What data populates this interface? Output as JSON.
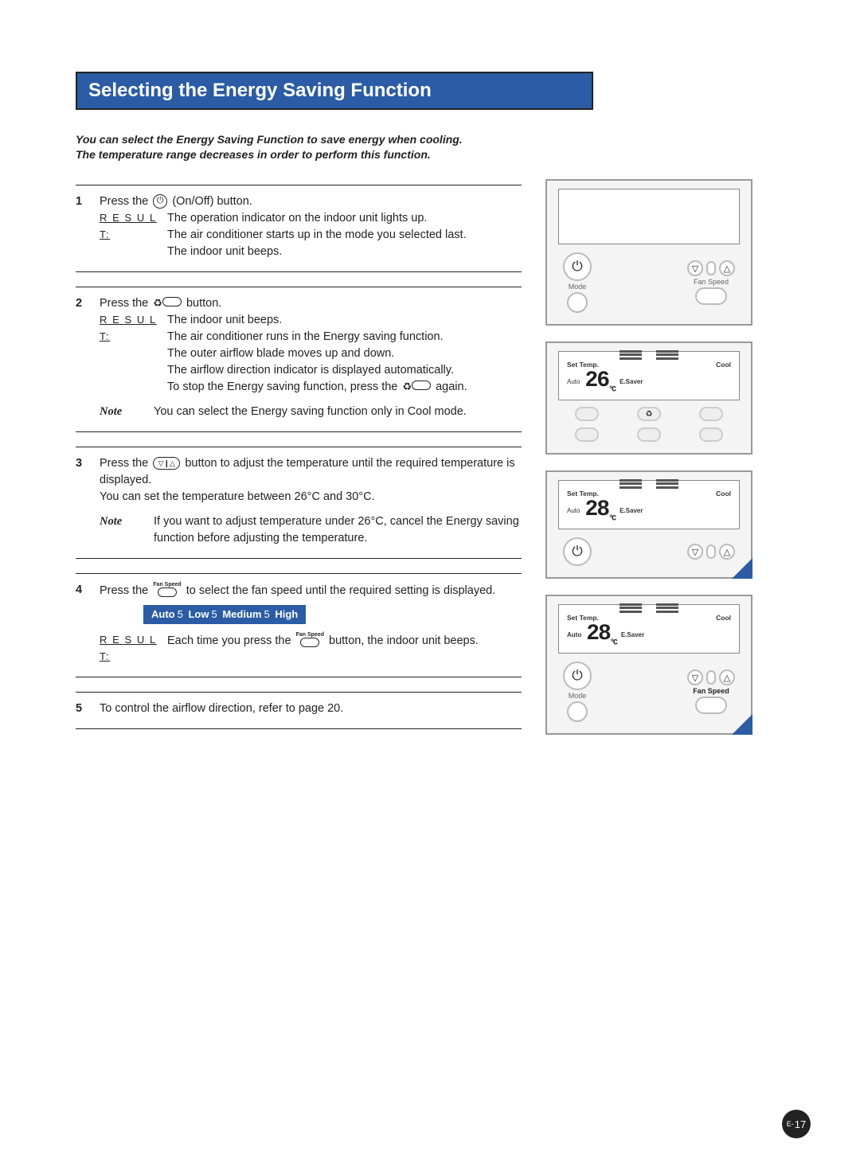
{
  "title": "Selecting the Energy Saving Function",
  "intro_line1": "You can select the Energy Saving Function to save energy when cooling.",
  "intro_line2": "The temperature range decreases in order to perform this function.",
  "steps": {
    "s1": {
      "num": "1",
      "press_a": "Press the ",
      "press_b": " (On/Off) button.",
      "result_label": "R E S U L T:",
      "r1": "The operation indicator on the indoor unit lights up.",
      "r2": "The air conditioner starts up in the mode you selected last.",
      "r3": "The indoor unit beeps."
    },
    "s2": {
      "num": "2",
      "press_a": "Press the ",
      "press_b": " button.",
      "result_label": "R E S U L T:",
      "r1": "The indoor unit beeps.",
      "r2": "The air conditioner runs in the Energy saving function.",
      "r3": "The outer airflow blade moves up and down.",
      "r4": "The airflow direction indicator is displayed automatically.",
      "r5a": "To stop the Energy saving function, press the ",
      "r5b": " again.",
      "note_label": "Note",
      "note": "You can select the Energy saving function only in Cool mode."
    },
    "s3": {
      "num": "3",
      "press_a": "Press the ",
      "press_b": " button to adjust the temperature until the required temperature is displayed.",
      "line2": "You can set the temperature between 26°C and 30°C.",
      "note_label": "Note",
      "note": "If you want to adjust temperature under 26°C, cancel the Energy saving function before adjusting the temperature."
    },
    "s4": {
      "num": "4",
      "press_a": "Press the ",
      "press_b": " to select the fan speed until the required setting is displayed.",
      "cycle": {
        "a": "Auto",
        "b": "Low",
        "c": "Medium",
        "d": "High",
        "sep": "5"
      },
      "result_label": "R E S U L T:",
      "ra": "Each time you press the ",
      "rb": " button, the indoor unit beeps."
    },
    "s5": {
      "num": "5",
      "text": "To control the airflow direction, refer to page 20."
    }
  },
  "panels": {
    "labels": {
      "mode": "Mode",
      "fanspeed": "Fan Speed",
      "fanspeed_bold": "Fan Speed",
      "set_temp": "Set Temp.",
      "cool": "Cool",
      "esaver": "E.Saver",
      "auto": "Auto"
    },
    "temp2": "26",
    "temp3": "28",
    "temp4": "28",
    "unit": "°C"
  },
  "icons": {
    "power": "⏻",
    "esaver": "♻",
    "down": "▽",
    "up": "△",
    "bar": "❙",
    "fan_label": "Fan Speed"
  },
  "page": {
    "prefix": "E-",
    "num": "17"
  }
}
